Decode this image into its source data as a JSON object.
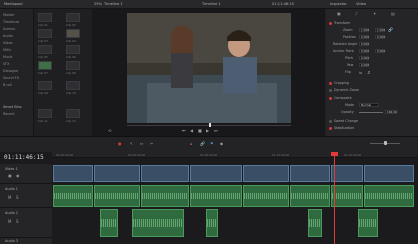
{
  "topbar": {
    "media_pool": "Mediapool",
    "zoom": "29%",
    "clip_name": "Timeline 1",
    "timecode": "01:11:46:15",
    "project": "Timeline 1",
    "inspector_title": "Inspector",
    "inspector_tab": "Video"
  },
  "sidebar": {
    "items": [
      "Master",
      "Timelines",
      "Scenes",
      "Audio",
      "Video",
      "Stills",
      "Music",
      "SFX",
      "Dialogue",
      "Sound FX",
      "B-roll",
      "Smart Bins",
      "Recent"
    ]
  },
  "media": {
    "thumb_labels": [
      "Clip 01",
      "Clip 02",
      "Clip 03",
      "Clip 04",
      "Clip 05",
      "Clip 06",
      "Clip 07",
      "Clip 08",
      "Clip 09",
      "Clip 10",
      "Clip 11",
      "Clip 12"
    ]
  },
  "inspector": {
    "section_transform": "Transform",
    "zoom_label": "Zoom",
    "zoom_x": "1.000",
    "zoom_y": "1.000",
    "position_label": "Position",
    "pos_x": "0.000",
    "pos_y": "0.000",
    "rotation_label": "Rotation Angle",
    "rotation": "0.000",
    "anchor_label": "Anchor Point",
    "anchor_x": "0.000",
    "anchor_y": "0.000",
    "pitch_label": "Pitch",
    "pitch": "0.000",
    "yaw_label": "Yaw",
    "yaw": "0.000",
    "flip_label": "Flip",
    "section_cropping": "Cropping",
    "section_dynamic_zoom": "Dynamic Zoom",
    "section_composite": "Composite",
    "mode_label": "Mode",
    "mode": "Normal",
    "opacity_label": "Opacity",
    "opacity": "100.00",
    "section_speed": "Speed Change",
    "section_stabilization": "Stabilization"
  },
  "timeline": {
    "timecode": "01:11:46:15",
    "v1_label": "Video 1",
    "a1_label": "Audio 1",
    "a2_label": "Audio 2",
    "a3_label": "Audio 3",
    "ruler": [
      "01:00:00:00",
      "01:04:00:00",
      "01:08:00:00",
      "01:12:00:00",
      "01:16:00:00"
    ]
  },
  "colors": {
    "accent": "#d03a3a",
    "audio_clip": "#2f6b3e",
    "video_clip": "#3a4e66"
  }
}
